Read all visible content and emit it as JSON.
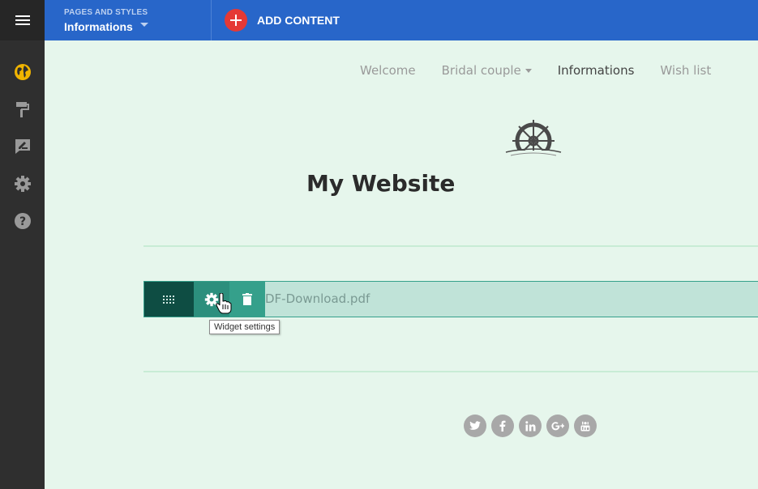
{
  "toolbar": {
    "menu_icon": "hamburger-icon",
    "pages_label": "PAGES AND STYLES",
    "current_page": "Informations",
    "add_content_label": "ADD CONTENT"
  },
  "sidebar": {
    "items": [
      {
        "icon": "globe-icon",
        "active": true
      },
      {
        "icon": "paint-roller-icon"
      },
      {
        "icon": "edit-comment-icon"
      },
      {
        "icon": "gear-icon"
      },
      {
        "icon": "help-icon"
      }
    ]
  },
  "site": {
    "nav": [
      "Welcome",
      "Bridal couple",
      "Informations",
      "Wish list"
    ],
    "active_nav": "Informations",
    "title": "My Website",
    "logo_icon": "ship-wheel-icon"
  },
  "widget": {
    "file_name": "DF-Download.pdf",
    "tooltip": "Widget settings"
  },
  "social": [
    "twitter-icon",
    "facebook-icon",
    "linkedin-icon",
    "google-plus-icon",
    "youtube-icon"
  ],
  "colors": {
    "topbar": "#2866c9",
    "sidebar": "#2f2f2f",
    "accent_icon": "#f0b400",
    "add_button": "#e53935",
    "page_bg": "#e6f6ec",
    "widget_dark": "#0e4d43",
    "widget_mid": "#2c8f7d",
    "widget_light": "#35a08b"
  }
}
